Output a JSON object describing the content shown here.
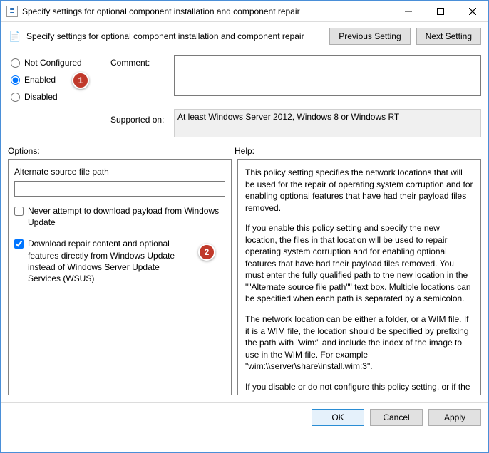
{
  "window": {
    "title": "Specify settings for optional component installation and component repair"
  },
  "toolbar": {
    "subtitle": "Specify settings for optional component installation and component repair",
    "prev_btn": "Previous Setting",
    "next_btn": "Next Setting"
  },
  "state": {
    "not_configured": "Not Configured",
    "enabled": "Enabled",
    "disabled": "Disabled",
    "selected": "enabled"
  },
  "labels": {
    "comment": "Comment:",
    "supported_on": "Supported on:",
    "options": "Options:",
    "help": "Help:"
  },
  "supported_text": "At least Windows Server 2012, Windows 8 or Windows RT",
  "options": {
    "alt_path_label": "Alternate source file path",
    "alt_path_value": "",
    "chk1_label": "Never attempt to download payload from Windows Update",
    "chk1_checked": false,
    "chk2_label": "Download repair content and optional features directly from Windows Update instead of Windows Server Update Services (WSUS)",
    "chk2_checked": true
  },
  "help_paragraphs": [
    "This policy setting specifies the network locations that will be used for the repair of operating system corruption and for enabling optional features that have had their payload files removed.",
    "If you enable this policy setting and specify the new location, the files in that location will be used to repair operating system corruption and for enabling optional features that have had their payload files removed. You must enter the fully qualified path to the new location in the \"\"Alternate source file path\"\" text box. Multiple locations can be specified when each path is separated by a semicolon.",
    "The network location can be either a folder, or a WIM file. If it is a WIM file, the location should be specified by prefixing the path with \"wim:\" and include the index of the image to use in the WIM file. For example \"wim:\\\\server\\share\\install.wim:3\".",
    "If you disable or do not configure this policy setting, or if the required files cannot be found at the locations specified in this"
  ],
  "footer": {
    "ok": "OK",
    "cancel": "Cancel",
    "apply": "Apply"
  },
  "markers": {
    "m1": "1",
    "m2": "2"
  }
}
